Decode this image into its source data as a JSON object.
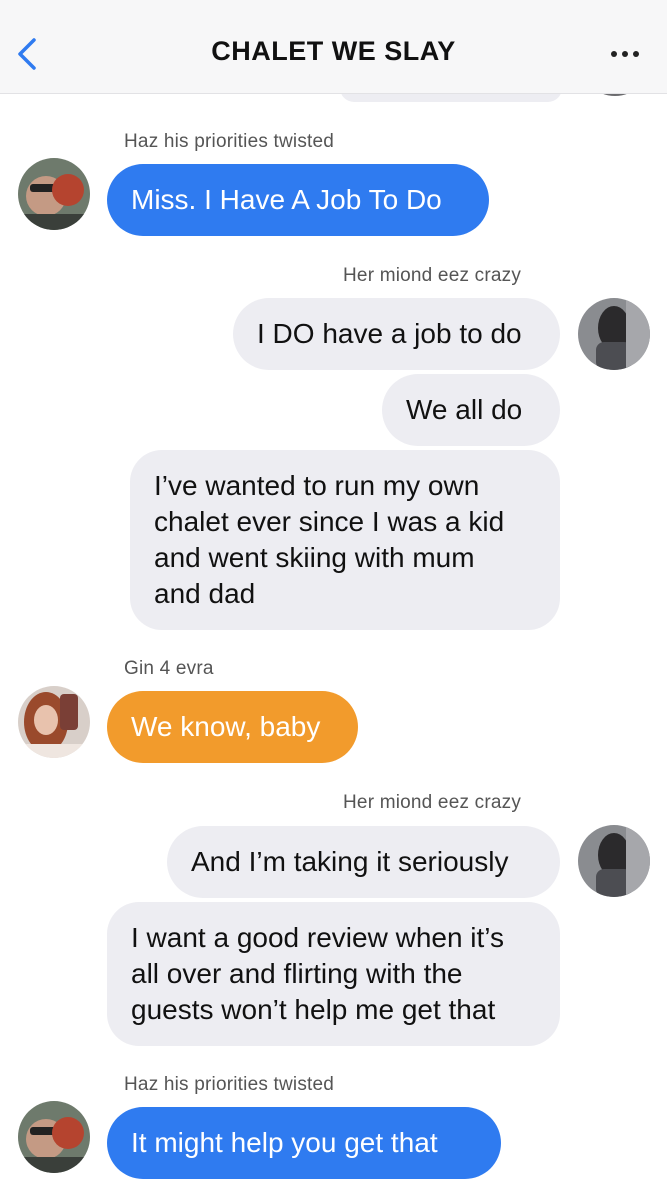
{
  "header": {
    "title": "CHALET WE SLAY",
    "back_icon": "chevron-left-icon",
    "more_icon": "ellipsis-icon",
    "accent": "#2f7bf0"
  },
  "messages": [
    {
      "sender": "Haz his priorities twisted",
      "text": "Miss. I Have A Job To Do",
      "color": "#2f7bf0",
      "side": "left"
    },
    {
      "sender": "Her miond eez crazy",
      "text": "I DO have a job to do",
      "side": "right"
    },
    {
      "text": "We all do",
      "side": "right"
    },
    {
      "text": "I’ve wanted to run my own\nchalet ever since I was a kid\nand went skiing with mum\nand dad",
      "side": "right"
    },
    {
      "sender": "Gin 4 evra",
      "text": "We know, baby",
      "color": "#f29b2c",
      "side": "left"
    },
    {
      "sender": "Her miond eez crazy",
      "text": "And I’m taking it seriously",
      "side": "right"
    },
    {
      "text": "I want a good review when it’s\nall over and flirting with the\nguests won’t help me get that",
      "side": "right"
    },
    {
      "sender": "Haz his priorities twisted",
      "text": "It might help you get that",
      "color": "#2f7bf0",
      "side": "left"
    }
  ]
}
